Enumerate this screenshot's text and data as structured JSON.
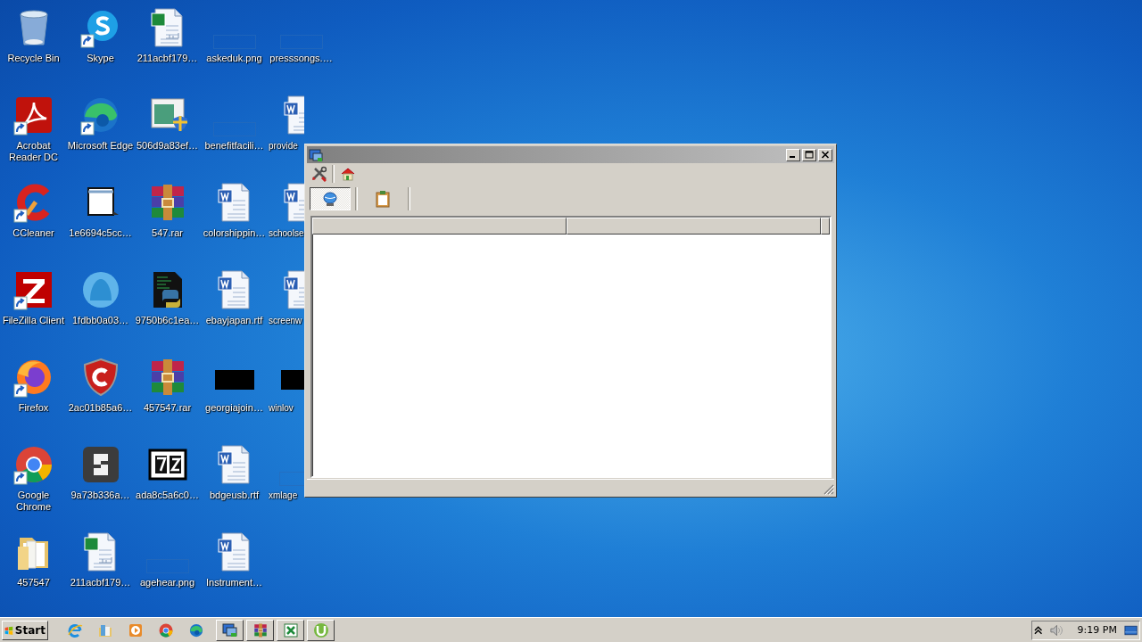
{
  "desktop": {
    "icons": [
      {
        "label": "Recycle Bin",
        "kind": "recycle",
        "shortcut": false
      },
      {
        "label": "Acrobat Reader DC",
        "kind": "pdf",
        "shortcut": true
      },
      {
        "label": "CCleaner",
        "kind": "ccleaner",
        "shortcut": true
      },
      {
        "label": "FileZilla Client",
        "kind": "filezilla",
        "shortcut": true
      },
      {
        "label": "Firefox",
        "kind": "firefox",
        "shortcut": true
      },
      {
        "label": "Google Chrome",
        "kind": "chrome",
        "shortcut": true
      },
      {
        "label": "457547",
        "kind": "folder",
        "shortcut": false
      },
      {
        "label": "Skype",
        "kind": "skype",
        "shortcut": true
      },
      {
        "label": "Microsoft Edge",
        "kind": "edge",
        "shortcut": true
      },
      {
        "label": "1e6694c5cc…",
        "kind": "window",
        "shortcut": false
      },
      {
        "label": "1fdbb0a03…",
        "kind": "blob",
        "shortcut": false
      },
      {
        "label": "2ac01b85a6…",
        "kind": "shield",
        "shortcut": false
      },
      {
        "label": "9a73b336a…",
        "kind": "sapp",
        "shortcut": false
      },
      {
        "label": "211acbf179…",
        "kind": "excel",
        "shortcut": false
      },
      {
        "label": "211acbf179…",
        "kind": "excel",
        "shortcut": false
      },
      {
        "label": "506d9a83ef…",
        "kind": "installer",
        "shortcut": false
      },
      {
        "label": "547.rar",
        "kind": "rar",
        "shortcut": false
      },
      {
        "label": "9750b6c1ea…",
        "kind": "python",
        "shortcut": false
      },
      {
        "label": "457547.rar",
        "kind": "rar",
        "shortcut": false
      },
      {
        "label": "ada8c5a6c0…",
        "kind": "sevenz",
        "shortcut": false
      },
      {
        "label": "agehear.png",
        "kind": "image",
        "shortcut": false
      },
      {
        "label": "askeduk.png",
        "kind": "image",
        "shortcut": false
      },
      {
        "label": "benefitfacili…",
        "kind": "image",
        "shortcut": false
      },
      {
        "label": "colorshippin…",
        "kind": "word",
        "shortcut": false
      },
      {
        "label": "ebayjapan.rtf",
        "kind": "word",
        "shortcut": false
      },
      {
        "label": "georgiajoin…",
        "kind": "black",
        "shortcut": false
      },
      {
        "label": "bdgeusb.rtf",
        "kind": "word",
        "shortcut": false
      },
      {
        "label": "Instrument…",
        "kind": "word",
        "shortcut": false
      },
      {
        "label": "presssongs.…",
        "kind": "image",
        "shortcut": false
      },
      {
        "label": "provide",
        "kind": "word",
        "shortcut": false
      },
      {
        "label": "schoolse",
        "kind": "word",
        "shortcut": false
      },
      {
        "label": "screenw",
        "kind": "word",
        "shortcut": false
      },
      {
        "label": "winlov",
        "kind": "black",
        "shortcut": false
      },
      {
        "label": "xmlage",
        "kind": "image",
        "shortcut": false
      }
    ]
  },
  "window": {
    "toolbar": [
      {
        "kind": "tools"
      },
      {
        "kind": "home"
      }
    ],
    "view_buttons": [
      {
        "kind": "globe",
        "selected": true
      },
      {
        "kind": "clipboard",
        "selected": false
      }
    ]
  },
  "taskbar": {
    "start": "Start",
    "quick_launch": [
      {
        "kind": "ie"
      },
      {
        "kind": "explorer"
      },
      {
        "kind": "media"
      },
      {
        "kind": "chrome"
      },
      {
        "kind": "edge"
      }
    ],
    "tasks": [
      {
        "kind": "app"
      },
      {
        "kind": "rar"
      },
      {
        "kind": "excel"
      },
      {
        "kind": "torrent"
      }
    ],
    "clock": "9:19 PM"
  }
}
